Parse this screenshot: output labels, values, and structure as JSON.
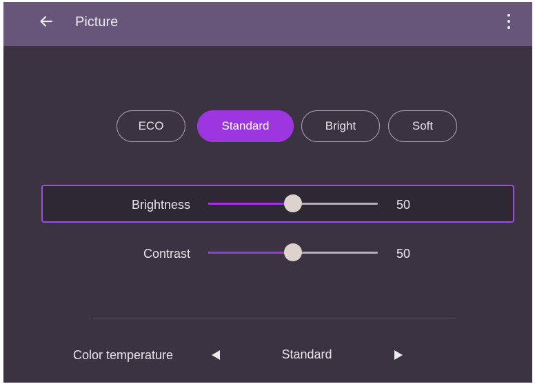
{
  "header": {
    "title": "Picture",
    "back_icon": "arrow-left-icon",
    "more_icon": "more-vertical-icon"
  },
  "modes": {
    "selected": "Standard",
    "items": [
      {
        "label": "ECO"
      },
      {
        "label": "Standard"
      },
      {
        "label": "Bright"
      },
      {
        "label": "Soft"
      }
    ]
  },
  "sliders": {
    "brightness": {
      "label": "Brightness",
      "value": "50",
      "fraction": 0.5
    },
    "contrast": {
      "label": "Contrast",
      "value": "50",
      "fraction": 0.5
    }
  },
  "color_temperature": {
    "label": "Color temperature",
    "value": "Standard",
    "prev_icon": "triangle-left-icon",
    "next_icon": "triangle-right-icon"
  },
  "colors": {
    "accent": "#9d36e0",
    "header_bg": "#675679",
    "background": "#3c3342",
    "thumb": "#ddd2cd"
  }
}
